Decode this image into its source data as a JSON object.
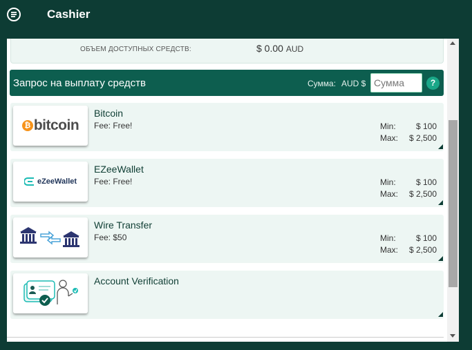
{
  "app": {
    "title": "Cashier"
  },
  "balance": {
    "label": "ОБЪЕМ ДОСТУПНЫХ СРЕДСТВ:",
    "amount": "$ 0.00",
    "currency": "AUD"
  },
  "request": {
    "title": "Запрос на выплату средств",
    "amount_label": "Сумма:",
    "currency_label": "AUD $",
    "amount_placeholder": "Сумма",
    "amount_value": "",
    "help_label": "?"
  },
  "methods": [
    {
      "name": "Bitcoin",
      "fee": "Fee: Free!",
      "min_label": "Min:",
      "min": "$ 100",
      "max_label": "Max:",
      "max": "$ 2,500",
      "logo_text": "bitcoin",
      "icon": "bitcoin-logo"
    },
    {
      "name": "EZeeWallet",
      "fee": "Fee: Free!",
      "min_label": "Min:",
      "min": "$ 100",
      "max_label": "Max:",
      "max": "$ 2,500",
      "logo_text": "eZeeWallet",
      "icon": "ezeewallet-logo"
    },
    {
      "name": "Wire Transfer",
      "fee": "Fee: $50",
      "min_label": "Min:",
      "min": "$ 100",
      "max_label": "Max:",
      "max": "$ 2,500",
      "icon": "bank-transfer-icon"
    },
    {
      "name": "Account Verification",
      "icon": "id-verification-icon"
    }
  ],
  "colors": {
    "header": "#0d3c34",
    "accent": "#0d5e4f",
    "card": "#edf6f3",
    "help": "#1aa788"
  }
}
